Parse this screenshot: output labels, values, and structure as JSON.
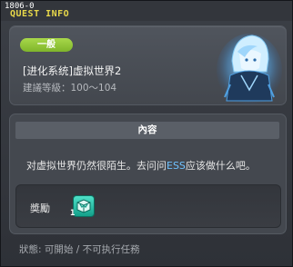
{
  "titlebar": {
    "quest_id": "1806-0",
    "title": "QUEST INFO"
  },
  "quest": {
    "category": "一般",
    "name": "[进化系统]虚拟世界2",
    "recommend_level": "建議等級：100～104",
    "npc_icon": "hooded-blue-npc-portrait"
  },
  "content": {
    "header": "內容",
    "text_before": "对虚拟世界仍然很陌生。去问问",
    "text_highlight": "ESS",
    "text_after": "应该做什么吧。"
  },
  "reward": {
    "label": "奬勵",
    "item_icon": "teal-box-item-icon",
    "item_count": "1"
  },
  "status": {
    "text": "狀態: 可開始 / 不可执行任務"
  },
  "colors": {
    "title": "#e8d84a",
    "badge": "#8fc43a",
    "highlight": "#6fc2ff"
  }
}
